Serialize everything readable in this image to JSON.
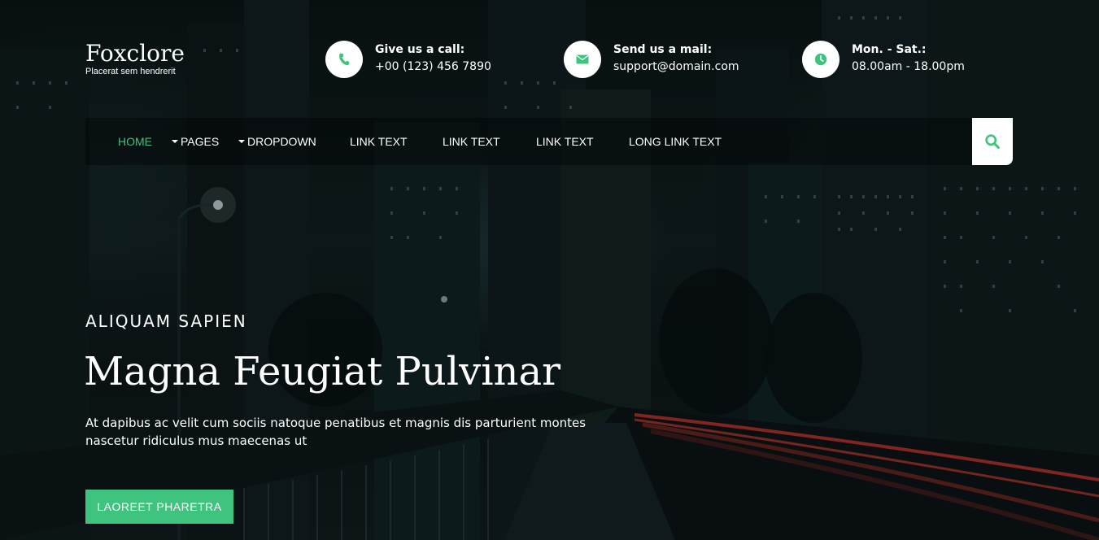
{
  "brand": {
    "name": "Foxclore",
    "tagline": "Placerat sem hendrerit"
  },
  "contacts": [
    {
      "label": "Give us a call:",
      "value": "+00 (123) 456 7890",
      "icon": "phone-icon"
    },
    {
      "label": "Send us a mail:",
      "value": "support@domain.com",
      "icon": "envelope-icon"
    },
    {
      "label": "Mon. - Sat.:",
      "value": "08.00am - 18.00pm",
      "icon": "clock-icon"
    }
  ],
  "nav": {
    "items": [
      {
        "label": "HOME",
        "active": true
      },
      {
        "label": "PAGES",
        "dropdown": true
      },
      {
        "label": "DROPDOWN",
        "dropdown": true
      },
      {
        "label": "LINK TEXT"
      },
      {
        "label": "LINK TEXT"
      },
      {
        "label": "LINK TEXT"
      },
      {
        "label": "LONG LINK TEXT"
      }
    ],
    "search_icon": "search-icon"
  },
  "hero": {
    "kicker": "ALIQUAM SAPIEN",
    "title": "Magna Feugiat Pulvinar",
    "description": "At dapibus ac velit cum sociis natoque penatibus et magnis dis parturient montes nascetur ridiculus mus maecenas ut",
    "cta_label": "LAOREET PHARETRA"
  },
  "colors": {
    "accent": "#3ec47e",
    "text": "#ffffff",
    "background": "#0b1214"
  }
}
